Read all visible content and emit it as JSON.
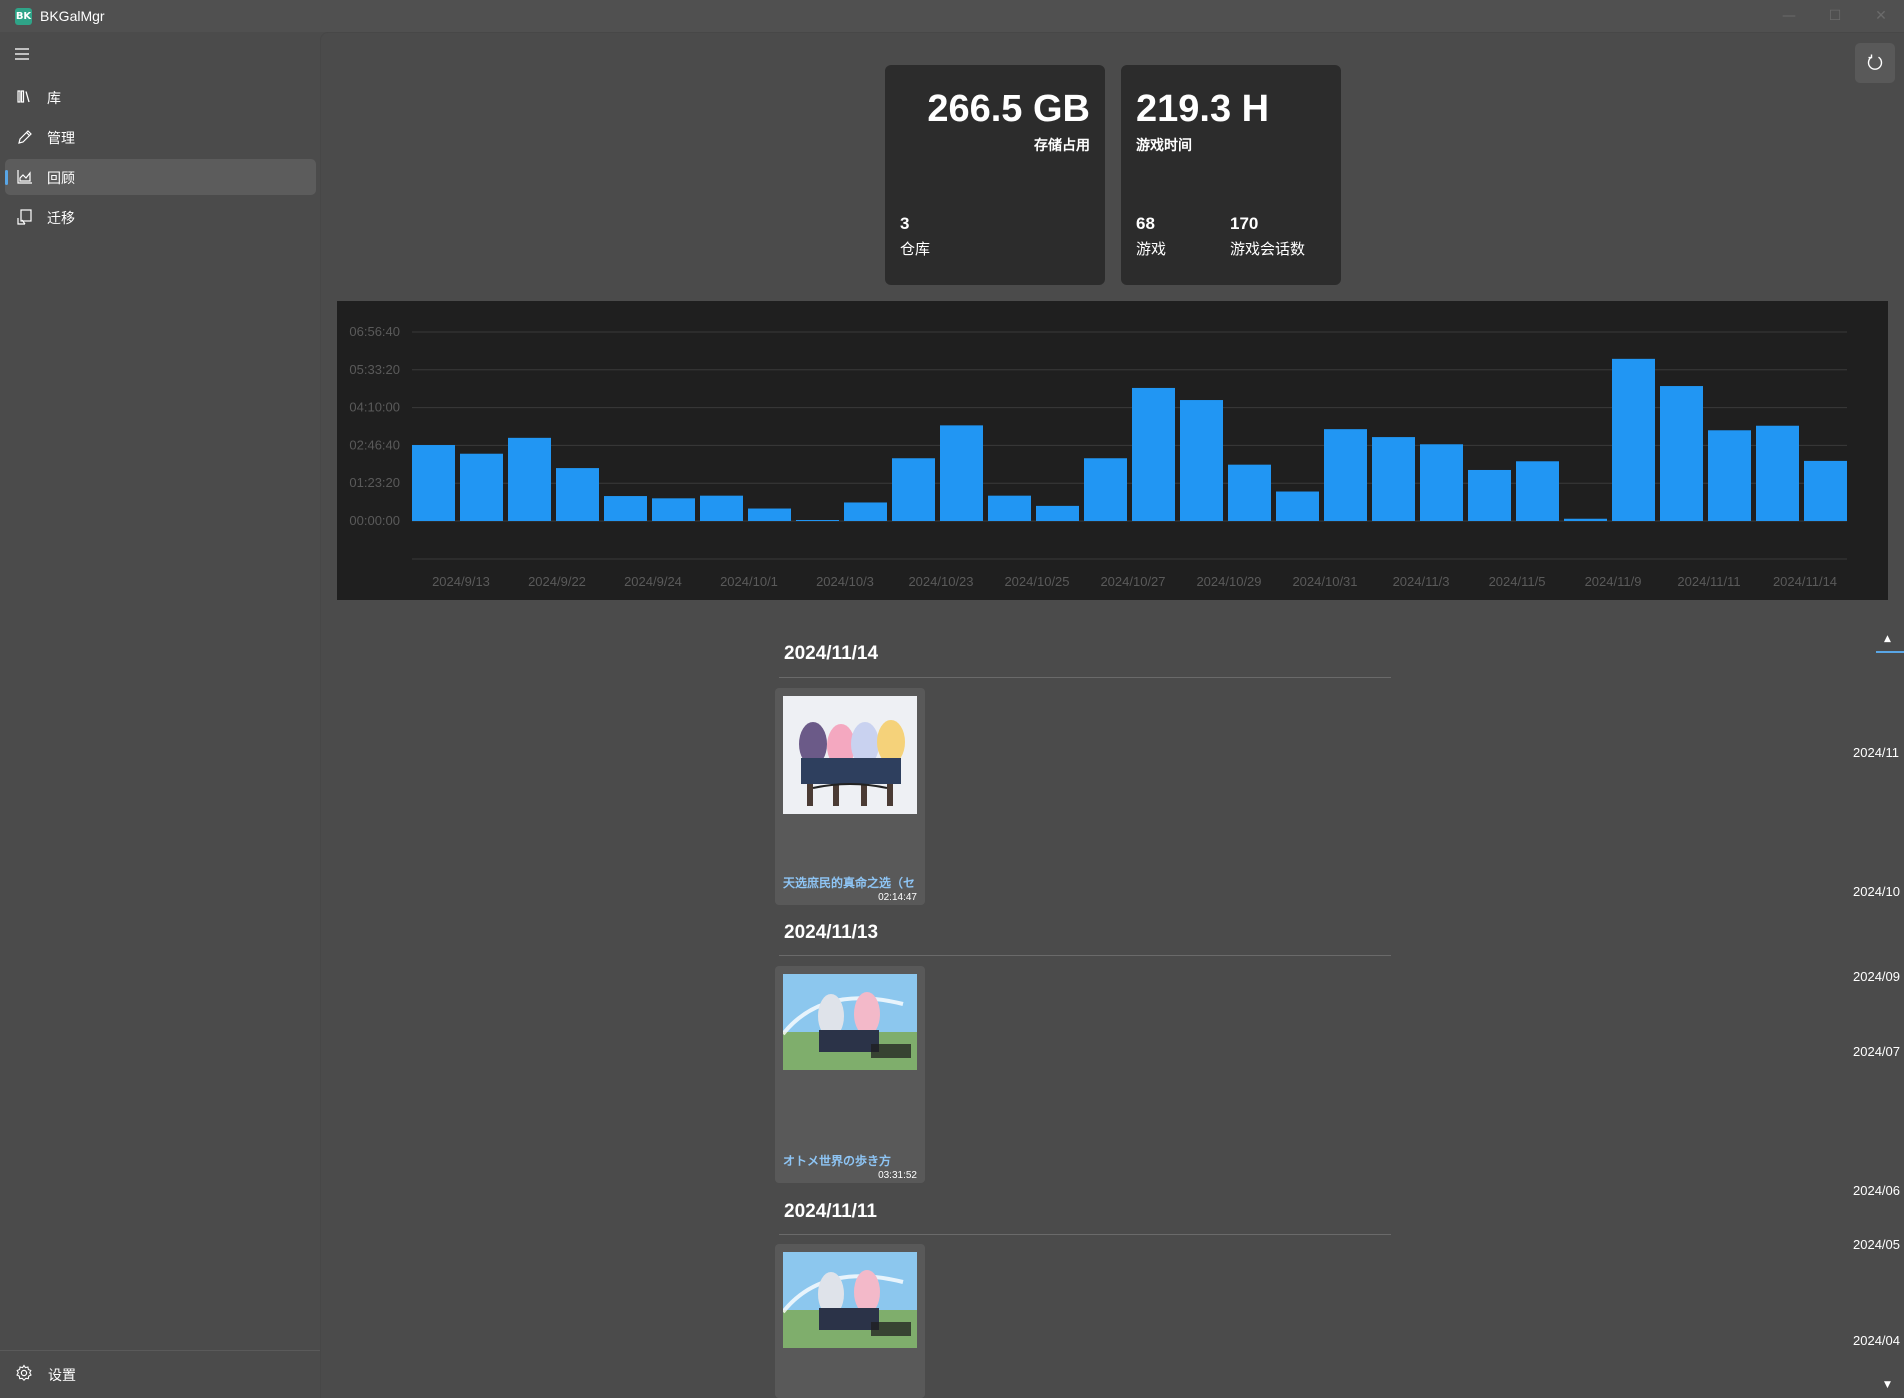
{
  "app": {
    "title": "BKGalMgr",
    "logo_text": "BK"
  },
  "window_controls": {
    "minimize": "—",
    "maximize": "☐",
    "close": "✕"
  },
  "sidebar": {
    "items": [
      {
        "label": "库",
        "icon": "library-icon"
      },
      {
        "label": "管理",
        "icon": "pencil-icon"
      },
      {
        "label": "回顾",
        "icon": "chart-icon",
        "selected": true
      },
      {
        "label": "迁移",
        "icon": "migrate-icon"
      }
    ],
    "settings_label": "设置"
  },
  "stats": {
    "storage": {
      "value": "266.5 GB",
      "label": "存储占用",
      "repo_count": "3",
      "repo_label": "仓库"
    },
    "playtime": {
      "value": "219.3 H",
      "label": "游戏时间",
      "game_count": "68",
      "game_label": "游戏",
      "session_count": "170",
      "session_label": "游戏会话数"
    }
  },
  "chart_data": {
    "type": "bar",
    "y_ticks": [
      "00:00:00",
      "01:23:20",
      "02:46:40",
      "04:10:00",
      "05:33:20",
      "06:56:40"
    ],
    "ylim_seconds": [
      0,
      25000
    ],
    "x_tick_labels": [
      "2024/9/13",
      "2024/9/22",
      "2024/9/24",
      "2024/10/1",
      "2024/10/3",
      "2024/10/23",
      "2024/10/25",
      "2024/10/27",
      "2024/10/29",
      "2024/10/31",
      "2024/11/3",
      "2024/11/5",
      "2024/11/9",
      "2024/11/11",
      "2024/11/14"
    ],
    "values_seconds": [
      10050,
      8900,
      11000,
      7000,
      3300,
      3000,
      3350,
      1650,
      100,
      2450,
      8300,
      12650,
      3350,
      2000,
      8300,
      17600,
      16000,
      7450,
      3900,
      12150,
      11100,
      10150,
      6750,
      7900,
      300,
      21450,
      17850,
      12000,
      12600,
      7950
    ],
    "bar_color": "#2196f3",
    "grid": true
  },
  "timeline": {
    "groups": [
      {
        "date": "2024/11/14",
        "game": "天选庶民的真命之选（セ",
        "duration": "02:14:47",
        "cover": "cover-a"
      },
      {
        "date": "2024/11/13",
        "game": "オトメ世界の歩き方",
        "duration": "03:31:52",
        "cover": "cover-b"
      },
      {
        "date": "2024/11/11",
        "game": "",
        "duration": "",
        "cover": "cover-b"
      }
    ],
    "scrubber_labels": [
      "2024/11",
      "2024/10",
      "2024/09",
      "2024/07",
      "2024/06",
      "2024/05",
      "2024/04"
    ]
  },
  "colors": {
    "accent": "#59a6e6",
    "background": "#4b4b4b",
    "card": "#2c2c2c",
    "chart_bg": "#1f1f1f"
  }
}
